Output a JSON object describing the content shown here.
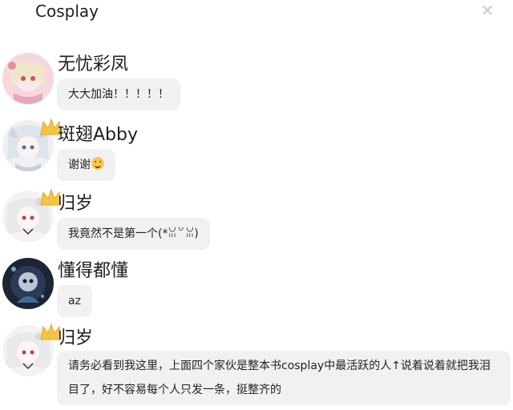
{
  "header": {
    "title": "Cosplay",
    "close_icon": "close-icon"
  },
  "messages": [
    {
      "name": "无忧彩凤",
      "text": "大大加油！！！！！",
      "crown": false
    },
    {
      "name": "斑翅Abby",
      "text": "谢谢",
      "emoji": "smiley-emoji",
      "crown": true
    },
    {
      "name": "归岁",
      "text": "我竟然不是第一个(*ꈍ꒵ꈍ)",
      "crown": true
    },
    {
      "name": "懂得都懂",
      "text": "az",
      "crown": false
    },
    {
      "name": "归岁",
      "text": "请务必看到我这里，上面四个家伙是整本书cosplay中最活跃的人↑说着说着就把我泪目了，好不容易每个人只发一条，挺整齐的",
      "crown": true
    }
  ],
  "colors": {
    "bubble": "#f1f1f2",
    "crown": "#f5c542",
    "close": "#c9c4dd"
  }
}
